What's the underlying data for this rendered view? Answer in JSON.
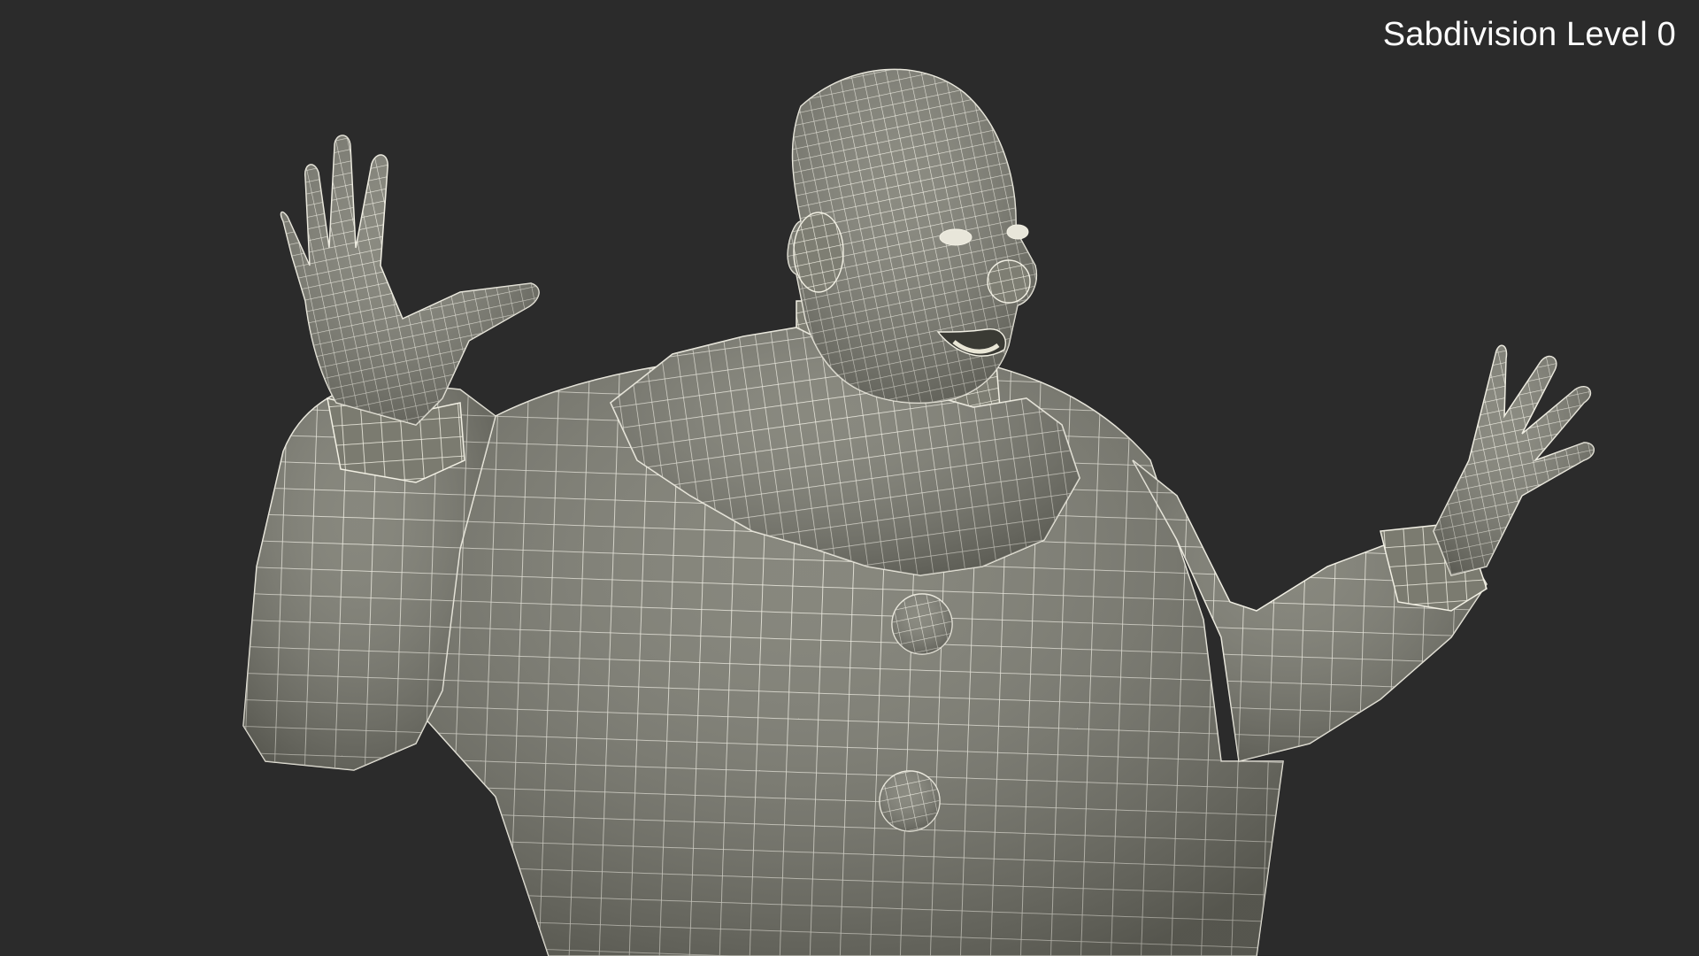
{
  "overlay": {
    "subdivision_label": "Sabdivision Level 0"
  },
  "scene": {
    "subject": "clown-wireframe-model",
    "background_color": "#2b2b2b",
    "mesh_fill_color": "#7b7b70",
    "wire_color": "#f2f0e4"
  }
}
